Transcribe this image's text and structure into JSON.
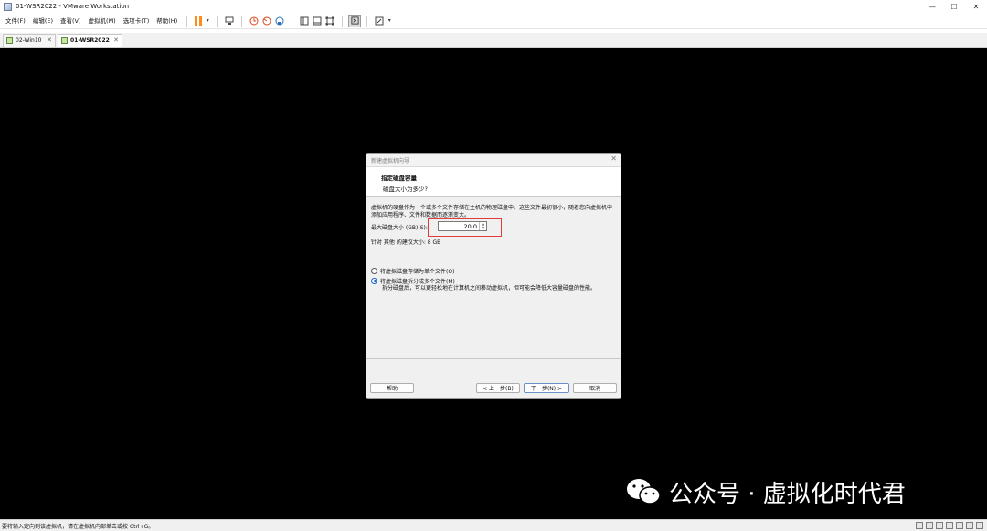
{
  "window": {
    "title": "01-WSR2022 - VMware Workstation",
    "controls": {
      "minimize": "—",
      "maximize": "☐",
      "close": "✕"
    }
  },
  "menu": {
    "items": [
      "文件(F)",
      "编辑(E)",
      "查看(V)",
      "虚拟机(M)",
      "选项卡(T)",
      "帮助(H)"
    ]
  },
  "toolbar": {
    "icons": [
      "pause-icon",
      "dropdown-icon",
      "send-ctrl-alt-del-icon",
      "snapshot-icon",
      "revert-snapshot-icon",
      "snapshot-manager-icon",
      "library-view-icon",
      "thumbnail-view-icon",
      "fullscreen-icon",
      "unity-icon",
      "console-icon",
      "stretch-icon"
    ],
    "dropdown_glyph": "▾"
  },
  "tabs": [
    {
      "label": "02-Win10",
      "active": false,
      "close": "✕"
    },
    {
      "label": "01-WSR2022",
      "active": true,
      "close": "✕"
    }
  ],
  "dialog": {
    "title": "新建虚拟机向导",
    "close": "✕",
    "header_title": "指定磁盘容量",
    "header_subtitle": "磁盘大小为多少?",
    "description": "虚拟机的硬盘作为一个或多个文件存储在主机的物理磁盘中。这些文件最初很小，随着您向虚拟机中添加应用程序、文件和数据而逐渐变大。",
    "size_label": "最大磁盘大小 (GB)(S):",
    "size_value": "20.0",
    "spin_up": "▲",
    "spin_down": "▼",
    "recommend": "针对 其他 的建议大小: 8 GB",
    "options": [
      {
        "label": "将虚拟磁盘存储为单个文件(O)",
        "checked": false
      },
      {
        "label": "将虚拟磁盘拆分成多个文件(M)",
        "checked": true
      }
    ],
    "split_description": "拆分磁盘后，可以更轻松地在计算机之间移动虚拟机，但可能会降低大容量磁盘的性能。",
    "buttons": {
      "help": "帮助",
      "back": "< 上一步(B)",
      "next": "下一步(N) >",
      "cancel": "取消"
    }
  },
  "watermark": {
    "text": "公众号 · 虚拟化时代君",
    "icon": "wechat-icon"
  },
  "statusbar": {
    "text": "要将输入定向到该虚拟机，请在虚拟机内部单击或按 Ctrl+G。"
  },
  "colors": {
    "console_bg": "#000000",
    "highlight": "#e23b3b",
    "pause_orange": "#ff8c1a"
  }
}
